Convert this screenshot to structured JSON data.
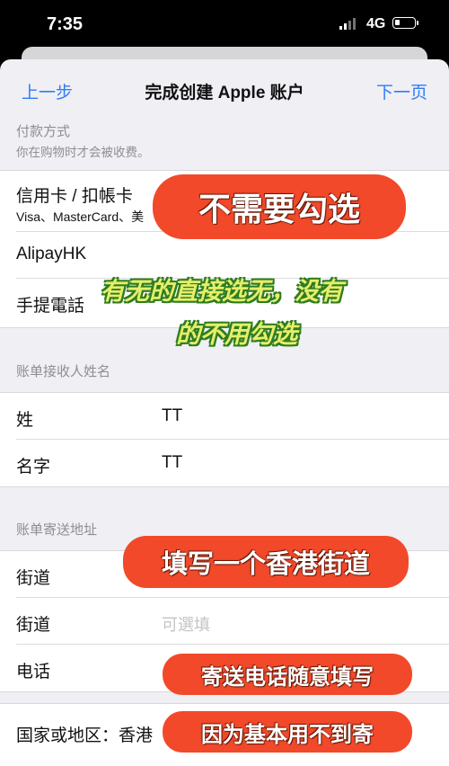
{
  "status_bar": {
    "time": "7:35",
    "network": "4G"
  },
  "nav": {
    "prev": "上一步",
    "title": "完成创建 Apple 账户",
    "next": "下一页"
  },
  "payment": {
    "header": "付款方式",
    "subheader": "你在购物时才会被收费。",
    "options": [
      {
        "label": "信用卡 / 扣帳卡",
        "sublabel": "Visa、MasterCard、美"
      },
      {
        "label": "AlipayHK"
      },
      {
        "label": "手提電話"
      }
    ]
  },
  "billing_name": {
    "header": "账单接收人姓名",
    "rows": [
      {
        "label": "姓",
        "value": "TT"
      },
      {
        "label": "名字",
        "value": "TT"
      }
    ]
  },
  "billing_address": {
    "header": "账单寄送地址",
    "street1_label": "街道",
    "street2_label": "街道",
    "street2_placeholder": "可選填",
    "phone_label": "电话"
  },
  "country": {
    "label": "国家或地区：香港"
  },
  "annotations": {
    "no_check": "不需要勾选",
    "green_line1": "有无的直接选无，没有",
    "green_line2": "的不用勾选",
    "hk_street": "填写一个香港街道",
    "phone_hint": "寄送电话随意填写",
    "mail_hint": "因为基本用不到寄"
  },
  "colors": {
    "accent": "#2f7bf5",
    "annotation_bubble": "#f2492a",
    "annotation_green_text": "#e6ee6a"
  }
}
